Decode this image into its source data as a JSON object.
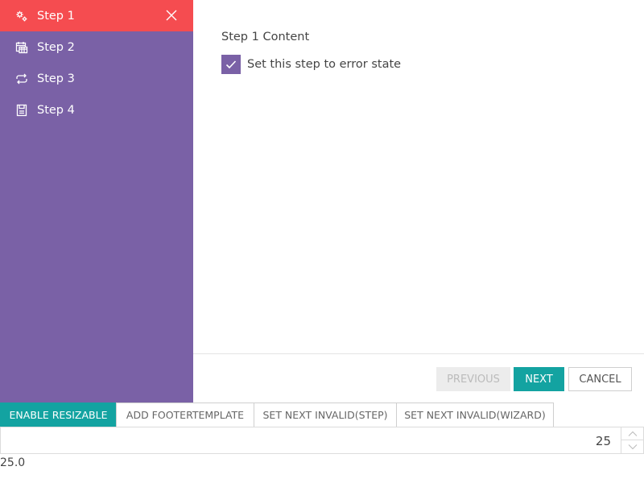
{
  "sidebar": {
    "steps": [
      {
        "label": "Step 1",
        "icon": "gears-icon",
        "active": true
      },
      {
        "label": "Step 2",
        "icon": "calendar-icon"
      },
      {
        "label": "Step 3",
        "icon": "repeat-icon"
      },
      {
        "label": "Step 4",
        "icon": "save-icon"
      }
    ]
  },
  "content": {
    "title": "Step 1 Content",
    "checkbox_label": "Set this step to error state",
    "checkbox_checked": true
  },
  "footer": {
    "previous": "PREVIOUS",
    "next": "NEXT",
    "cancel": "CANCEL"
  },
  "toolbar": {
    "enable_resizable": "ENABLE RESIZABLE",
    "add_footer_template": "ADD FOOTERTEMPLATE",
    "set_next_invalid_step": "SET NEXT INVALID(STEP)",
    "set_next_invalid_wizard": "SET NEXT INVALID(WIZARD)"
  },
  "numeric": {
    "value": "25"
  },
  "readout": "25.0",
  "colors": {
    "sidebar": "#7a61a6",
    "active_step": "#f54c50",
    "accent": "#13a3a1"
  }
}
